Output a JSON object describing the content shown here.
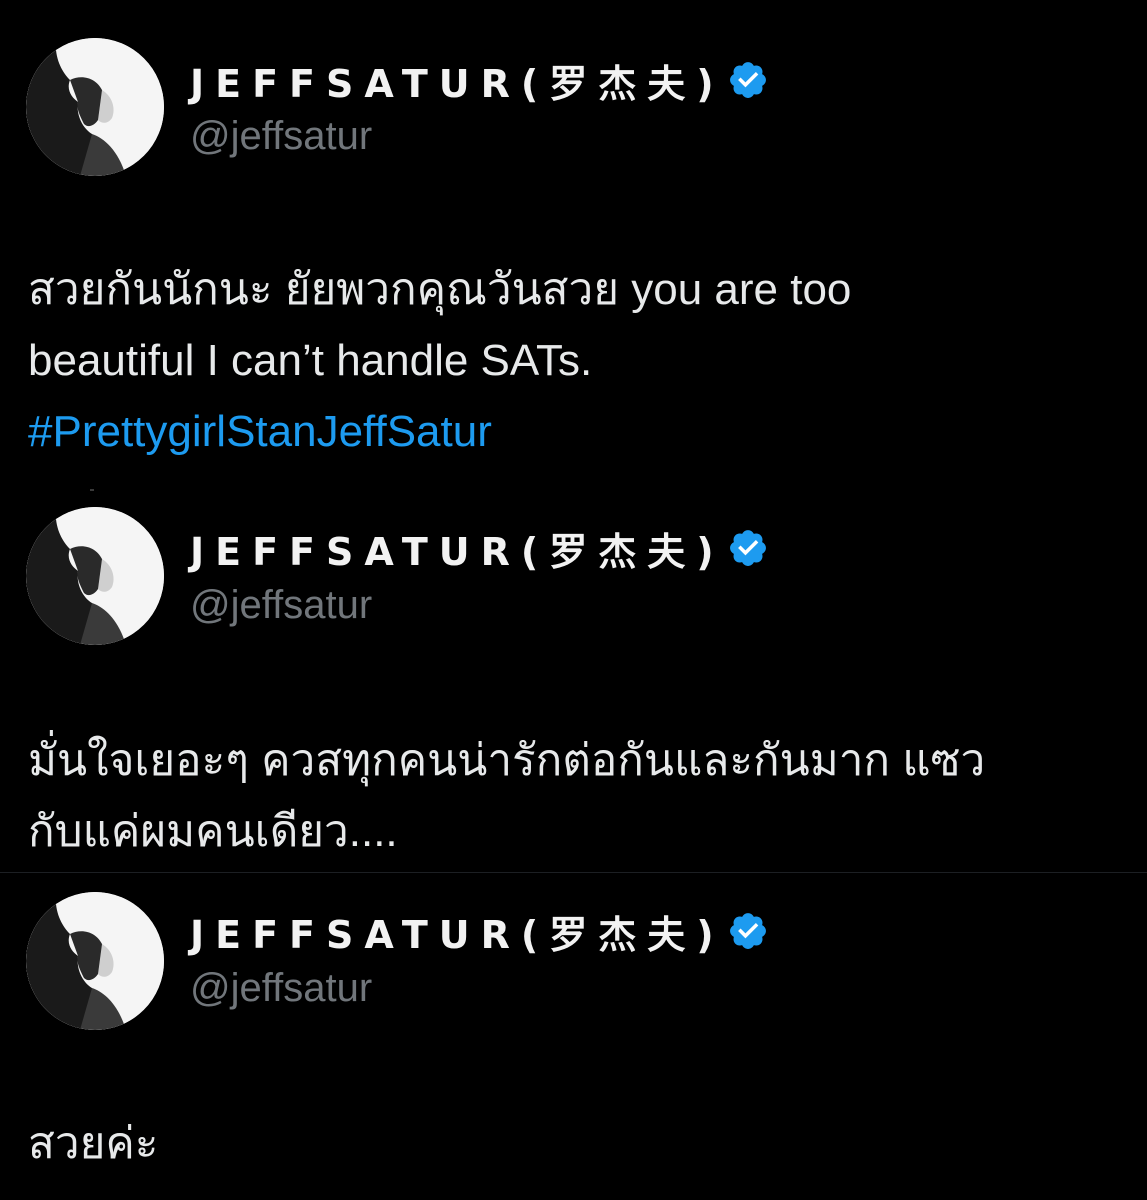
{
  "colors": {
    "background": "#000000",
    "text": "#e7e9ea",
    "handle": "#71767b",
    "hashtag": "#1d9bf0",
    "verified_badge": "#1d9bf0"
  },
  "tweets": [
    {
      "author": {
        "display_name": "JEFFSATUR(罗杰夫)",
        "handle": "@jeffsatur",
        "verified": true,
        "avatar_icon": "profile-avatar"
      },
      "text_lines": [
        "สวยกันนักนะ ยัยพวกคุณวันสวย you are too",
        "beautiful I can’t handle SATs."
      ],
      "hashtag": "#PrettygirlStanJeffSatur"
    },
    {
      "author": {
        "display_name": "JEFFSATUR(罗杰夫)",
        "handle": "@jeffsatur",
        "verified": true,
        "avatar_icon": "profile-avatar"
      },
      "text_lines": [
        "มั่นใจเยอะๆ ควสทุกคนน่ารักต่อกันและกันมาก แซว",
        "กับแค่ผมคนเดียว...."
      ]
    },
    {
      "author": {
        "display_name": "JEFFSATUR(罗杰夫)",
        "handle": "@jeffsatur",
        "verified": true,
        "avatar_icon": "profile-avatar"
      },
      "text_lines": [
        "สวยค่ะ"
      ]
    }
  ]
}
